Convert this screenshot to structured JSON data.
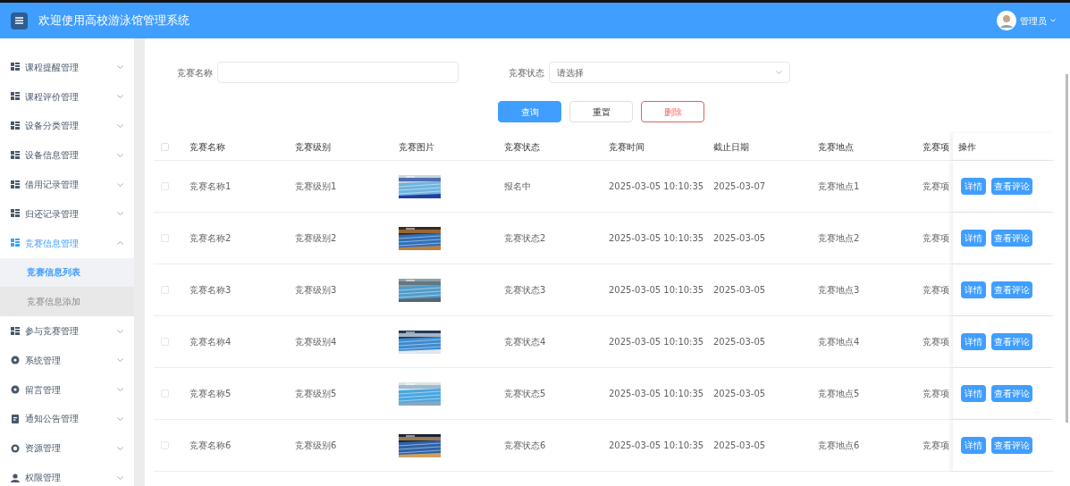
{
  "header": {
    "title": "欢迎使用高校游泳馆管理系统",
    "user": "管理员"
  },
  "sidebar": {
    "items": [
      {
        "label": "课程提醒管理",
        "kind": "grid",
        "expanded": false
      },
      {
        "label": "课程评价管理",
        "kind": "grid",
        "expanded": false
      },
      {
        "label": "设备分类管理",
        "kind": "grid",
        "expanded": false
      },
      {
        "label": "设备信息管理",
        "kind": "grid",
        "expanded": false
      },
      {
        "label": "借用记录管理",
        "kind": "grid",
        "expanded": false
      },
      {
        "label": "归还记录管理",
        "kind": "grid",
        "expanded": false
      },
      {
        "label": "竞赛信息管理",
        "kind": "grid",
        "expanded": true,
        "children": [
          {
            "label": "竞赛信息列表",
            "selected": true
          },
          {
            "label": "竞赛信息添加",
            "selected": false
          }
        ]
      },
      {
        "label": "参与竞赛管理",
        "kind": "grid",
        "expanded": false
      },
      {
        "label": "系统管理",
        "kind": "gear",
        "expanded": false
      },
      {
        "label": "留言管理",
        "kind": "gear",
        "expanded": false
      },
      {
        "label": "通知公告管理",
        "kind": "doc",
        "expanded": false
      },
      {
        "label": "资源管理",
        "kind": "ring",
        "expanded": false
      },
      {
        "label": "权限管理",
        "kind": "user",
        "expanded": false
      }
    ]
  },
  "filters": [
    {
      "label": "竞赛名称",
      "kind": "input"
    },
    {
      "label": "竞赛状态",
      "kind": "select",
      "placeholder": "请选择"
    }
  ],
  "buttons": [
    {
      "label": "查询",
      "kind": "primary"
    },
    {
      "label": "重置",
      "kind": "plain"
    },
    {
      "label": "删除",
      "kind": "danger"
    }
  ],
  "table": {
    "all_checked": false,
    "columns": [
      "竞赛名称",
      "竞赛级别",
      "竞赛图片",
      "竞赛状态",
      "竞赛时间",
      "截止日期",
      "竞赛地点",
      "竞赛项",
      "操作"
    ],
    "rows": [
      {
        "checked": false,
        "cells": [
          "竞赛名称1",
          "竞赛级别1",
          "",
          "报名中",
          "2025-03-05 10:10:35",
          "2025-03-07",
          "竞赛地点1",
          "竞赛项"
        ],
        "image": {
          "kind": "picture"
        },
        "actions": [
          "详情",
          "查看评论"
        ]
      },
      {
        "checked": false,
        "cells": [
          "竞赛名称2",
          "竞赛级别2",
          "",
          "竞赛状态2",
          "2025-03-05 10:10:35",
          "2025-03-05",
          "竞赛地点2",
          "竞赛项"
        ],
        "image": {
          "kind": "picture"
        },
        "actions": [
          "详情",
          "查看评论"
        ]
      },
      {
        "checked": false,
        "cells": [
          "竞赛名称3",
          "竞赛级别3",
          "",
          "竞赛状态3",
          "2025-03-05 10:10:35",
          "2025-03-05",
          "竞赛地点3",
          "竞赛项"
        ],
        "image": {
          "kind": "picture"
        },
        "actions": [
          "详情",
          "查看评论"
        ]
      },
      {
        "checked": false,
        "cells": [
          "竞赛名称4",
          "竞赛级别4",
          "",
          "竞赛状态4",
          "2025-03-05 10:10:35",
          "2025-03-05",
          "竞赛地点4",
          "竞赛项"
        ],
        "image": {
          "kind": "picture"
        },
        "actions": [
          "详情",
          "查看评论"
        ]
      },
      {
        "checked": false,
        "cells": [
          "竞赛名称5",
          "竞赛级别5",
          "",
          "竞赛状态5",
          "2025-03-05 10:10:35",
          "2025-03-05",
          "竞赛地点5",
          "竞赛项"
        ],
        "image": {
          "kind": "picture"
        },
        "actions": [
          "详情",
          "查看评论"
        ]
      },
      {
        "checked": false,
        "cells": [
          "竞赛名称6",
          "竞赛级别6",
          "",
          "竞赛状态6",
          "2025-03-05 10:10:35",
          "2025-03-05",
          "竞赛地点6",
          "竞赛项"
        ],
        "image": {
          "kind": "picture"
        },
        "actions": [
          "详情",
          "查看评论"
        ]
      }
    ]
  }
}
